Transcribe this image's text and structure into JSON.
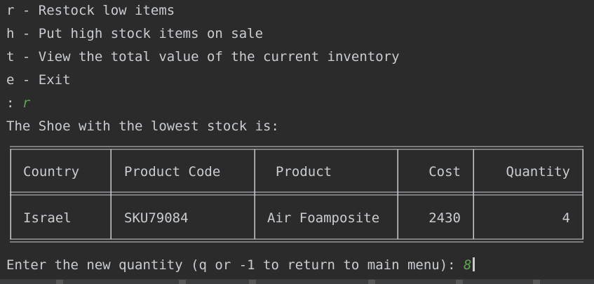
{
  "console": {
    "menu": [
      "r - Restock low items",
      "h - Put high stock items on sale",
      "t - View the total value of the current inventory",
      "e - Exit"
    ],
    "prompt_symbol": ": ",
    "menu_input": "r",
    "message": "The Shoe with the lowest stock is:",
    "table": {
      "headers": [
        "Country",
        "Product Code",
        "Product",
        "Cost",
        "Quantity"
      ],
      "row": [
        "Israel",
        "SKU79084",
        "Air Foamposite",
        "2430",
        "4"
      ]
    },
    "quantity_prompt": "Enter the new quantity (q or -1 to return to main menu): ",
    "quantity_input": "8"
  },
  "colors": {
    "background": "#2b2b2b",
    "text": "#c9cdd2",
    "user_input": "#5fa84f"
  }
}
